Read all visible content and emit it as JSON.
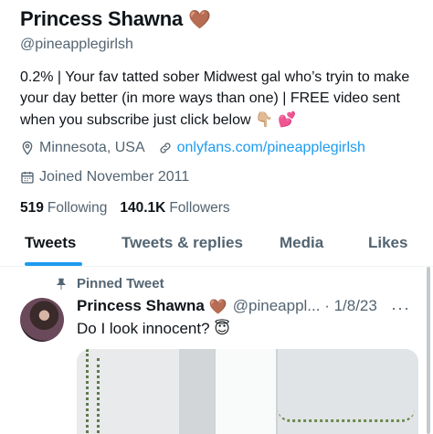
{
  "profile": {
    "name": "Princess Shawna",
    "name_emoji": "🤎",
    "handle": "@pineapplegirlsh",
    "bio": "0.2% | Your fav tatted sober Midwest gal who’s tryin to make your day better (in more ways than one) | FREE video sent when you subscribe just click below",
    "bio_emoji": "👇🏼 💕",
    "location": "Minnesota, USA",
    "website": "onlyfans.com/pineapplegirlsh",
    "joined": "Joined November 2011",
    "following_count": "519",
    "following_label": "Following",
    "followers_count": "140.1K",
    "followers_label": "Followers"
  },
  "tabs": [
    "Tweets",
    "Tweets & replies",
    "Media",
    "Likes"
  ],
  "tweet": {
    "pinned_label": "Pinned Tweet",
    "author": "Princess Shawna",
    "author_emoji": "🤎",
    "handle_date": "@pineappl... · 1/8/23",
    "more": "···",
    "text": "Do I look innocent?",
    "text_emoji": "😇"
  },
  "icons": {
    "location": "map-pin-icon",
    "link": "link-icon",
    "calendar": "calendar-icon",
    "pin": "pin-icon"
  },
  "colors": {
    "accent": "#1d9bf0",
    "secondary_text": "#536471"
  }
}
